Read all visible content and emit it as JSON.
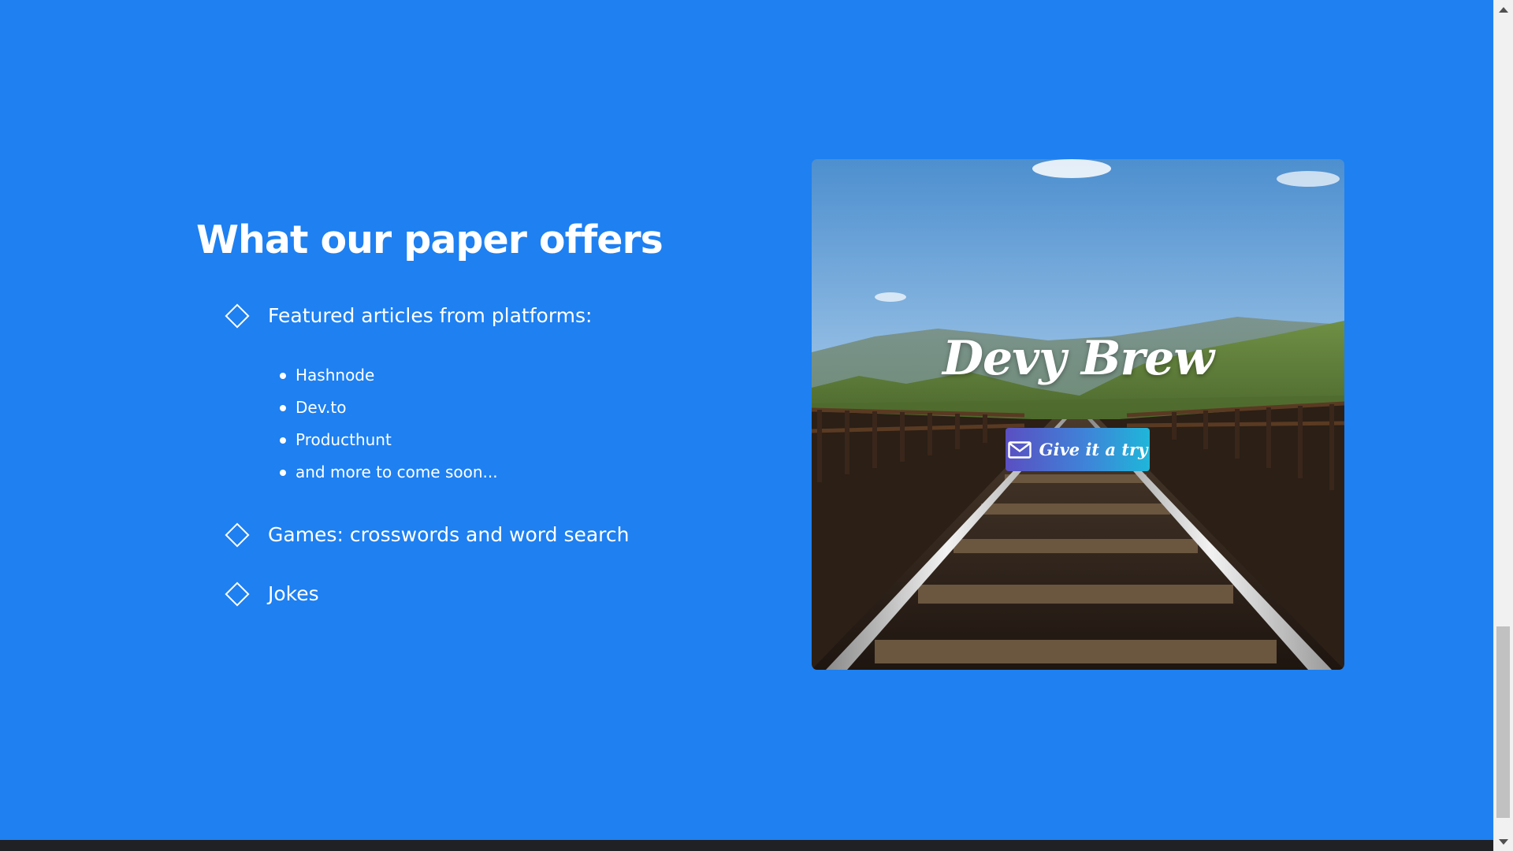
{
  "section": {
    "heading": "What our paper offers",
    "features": [
      {
        "label": "Featured articles from platforms:",
        "icon": "diamond-icon"
      },
      {
        "label": "Games: crosswords and word search",
        "icon": "diamond-icon"
      },
      {
        "label": "Jokes",
        "icon": "diamond-icon"
      }
    ],
    "platforms": [
      "Hashnode",
      "Dev.to",
      "Producthunt",
      "and more to come soon..."
    ]
  },
  "card": {
    "brand": "Devy Brew",
    "button_label": "Give it a try",
    "button_icon": "mail-icon",
    "image": "railway-bridge-photo"
  },
  "colors": {
    "background": "#1e80f1",
    "text": "#ffffff",
    "button_gradient_start": "#5a4fc2",
    "button_gradient_end": "#1fb6d9",
    "footer": "#202124"
  }
}
